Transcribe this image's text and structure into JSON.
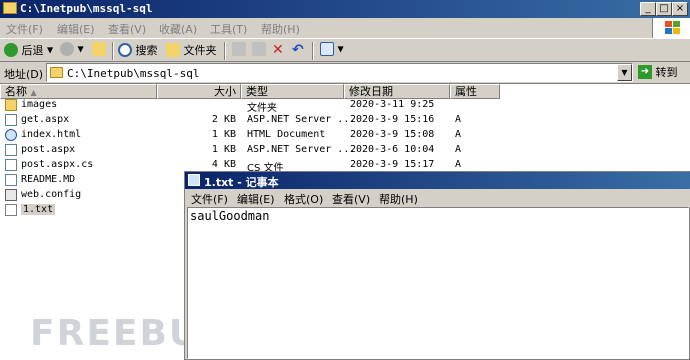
{
  "explorer": {
    "title": "C:\\Inetpub\\mssql-sql",
    "menu": [
      "文件(F)",
      "编辑(E)",
      "查看(V)",
      "收藏(A)",
      "工具(T)",
      "帮助(H)"
    ],
    "toolbar": {
      "back_label": "后退",
      "search_label": "搜索",
      "folders_label": "文件夹"
    },
    "address": {
      "label": "地址(D)",
      "value": "C:\\Inetpub\\mssql-sql",
      "go_label": "转到"
    },
    "columns": [
      "名称",
      "大小",
      "类型",
      "修改日期",
      "属性"
    ],
    "files": [
      {
        "name": "images",
        "size": "",
        "type": "文件夹",
        "modified": "2020-3-11 9:25",
        "attr": "",
        "icon": "folder-icon"
      },
      {
        "name": "get.aspx",
        "size": "2 KB",
        "type": "ASP.NET Server ...",
        "modified": "2020-3-9 15:16",
        "attr": "A",
        "icon": "aspx-file-icon"
      },
      {
        "name": "index.html",
        "size": "1 KB",
        "type": "HTML Document",
        "modified": "2020-3-9 15:08",
        "attr": "A",
        "icon": "html-file-icon"
      },
      {
        "name": "post.aspx",
        "size": "1 KB",
        "type": "ASP.NET Server ...",
        "modified": "2020-3-6 10:04",
        "attr": "A",
        "icon": "aspx-file-icon"
      },
      {
        "name": "post.aspx.cs",
        "size": "4 KB",
        "type": "CS 文件",
        "modified": "2020-3-9 15:17",
        "attr": "A",
        "icon": "cs-file-icon"
      },
      {
        "name": "README.MD",
        "size": "",
        "type": "",
        "modified": "",
        "attr": "",
        "icon": "md-file-icon"
      },
      {
        "name": "web.config",
        "size": "",
        "type": "",
        "modified": "",
        "attr": "",
        "icon": "config-file-icon"
      },
      {
        "name": "1.txt",
        "size": "",
        "type": "",
        "modified": "",
        "attr": "",
        "icon": "txt-file-icon"
      }
    ]
  },
  "notepad": {
    "title": "1.txt - 记事本",
    "menu": [
      "文件(F)",
      "编辑(E)",
      "格式(O)",
      "查看(V)",
      "帮助(H)"
    ],
    "content": "saulGoodman"
  },
  "watermark": "FREEBUF"
}
